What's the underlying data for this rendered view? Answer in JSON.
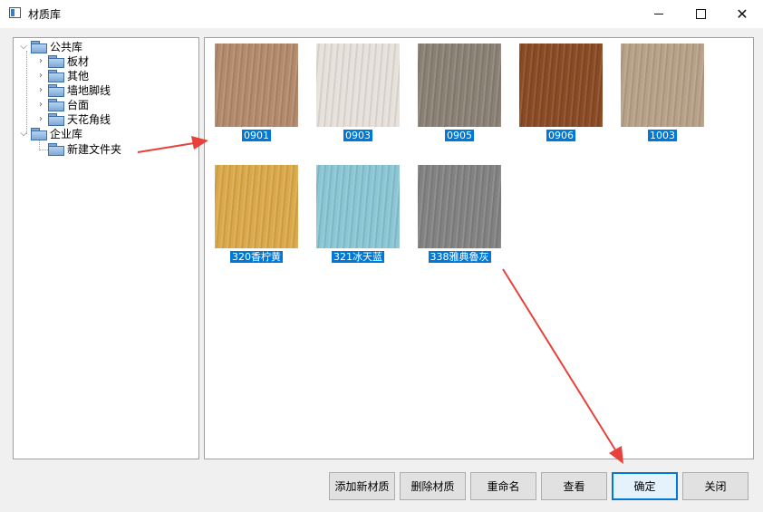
{
  "window": {
    "title": "材质库"
  },
  "tree": {
    "nodes": [
      {
        "label": "公共库",
        "children": [
          {
            "label": "板材"
          },
          {
            "label": "其他"
          },
          {
            "label": "墙地脚线"
          },
          {
            "label": "台面"
          },
          {
            "label": "天花角线"
          }
        ]
      },
      {
        "label": "企业库",
        "children": [
          {
            "label": "新建文件夹"
          }
        ]
      }
    ]
  },
  "materials": [
    {
      "label": "0901",
      "color": "#b38a6c"
    },
    {
      "label": "0903",
      "color": "#e7e1db"
    },
    {
      "label": "0905",
      "color": "#8a8174"
    },
    {
      "label": "0906",
      "color": "#8a4a24"
    },
    {
      "label": "1003",
      "color": "#b7a188"
    },
    {
      "label": "320香柠黄",
      "color": "#dba94a"
    },
    {
      "label": "321冰天蓝",
      "color": "#8ac6d4"
    },
    {
      "label": "338雅典魯灰",
      "color": "#828282"
    }
  ],
  "buttons": {
    "add_material": "添加新材质",
    "delete_material": "删除材质",
    "rename": "重命名",
    "view": "查看",
    "confirm": "确定",
    "close": "关闭"
  },
  "annotation_color": "#e8413b"
}
